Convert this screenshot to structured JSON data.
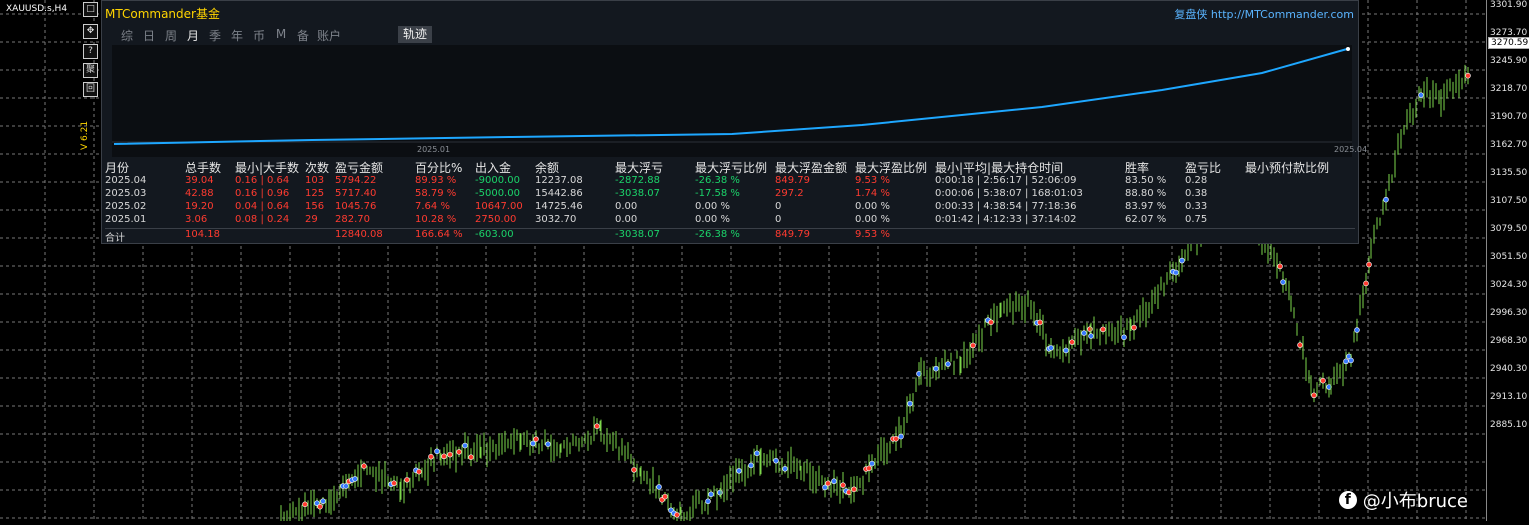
{
  "chart": {
    "symbol": "XAUUSD.s,H4",
    "version": "V 6.21",
    "current_price": "3270.59",
    "price_ticks": [
      "3301.90",
      "3273.70",
      "3245.90",
      "3218.70",
      "3190.70",
      "3162.70",
      "3135.50",
      "3107.50",
      "3079.50",
      "3051.50",
      "3024.30",
      "2996.30",
      "2968.30",
      "2940.30",
      "2913.10",
      "2885.10"
    ],
    "side_buttons": [
      "□",
      "✥",
      "?",
      "聚",
      "回"
    ]
  },
  "panel": {
    "brand": "MTCommander基金",
    "promo": "复盘侠 http://MTCommander.com",
    "tabs": [
      {
        "label": "综",
        "active": false
      },
      {
        "label": "日",
        "active": false
      },
      {
        "label": "周",
        "active": false
      },
      {
        "label": "月",
        "active": true
      },
      {
        "label": "季",
        "active": false
      },
      {
        "label": "年",
        "active": false
      },
      {
        "label": "币",
        "active": false
      },
      {
        "label": "M",
        "active": false
      },
      {
        "label": "备",
        "active": false
      },
      {
        "label": "账户",
        "active": false
      }
    ],
    "track_button": "轨迹",
    "mini_chart": {
      "date_start": "2025.01",
      "date_end": "2025.04",
      "line_color": "#1ea7ff"
    }
  },
  "stats": {
    "headers": {
      "month": "月份",
      "lots": "总手数",
      "minmax": "最小|大手数",
      "count": "次数",
      "pnl": "盈亏金额",
      "pct": "百分比%",
      "flow": "出入金",
      "bal": "余额",
      "float": "最大浮亏",
      "floatpct": "最大浮亏比例",
      "floatprofit": "最大浮盈金额",
      "floatprofitpct": "最大浮盈比例",
      "hold": "最小|平均|最大持仓时间",
      "win": "胜率",
      "ratio": "盈亏比",
      "margin": "最小预付款比例"
    },
    "rows": [
      {
        "month": "2025.04",
        "lots": "39.04",
        "minmax": "0.16 | 0.64",
        "count": "103",
        "pnl": "5794.22",
        "pct": "89.93 %",
        "flow": "-9000.00",
        "bal": "12237.08",
        "float": "-2872.88",
        "floatpct": "-26.38 %",
        "floatprofit": "849.79",
        "floatprofitpct": "9.53 %",
        "hold": "0:00:18 | 2:56:17 | 52:06:09",
        "win": "83.50 %",
        "ratio": "0.28",
        "margin": ""
      },
      {
        "month": "2025.03",
        "lots": "42.88",
        "minmax": "0.16 | 0.96",
        "count": "125",
        "pnl": "5717.40",
        "pct": "58.79 %",
        "flow": "-5000.00",
        "bal": "15442.86",
        "float": "-3038.07",
        "floatpct": "-17.58 %",
        "floatprofit": "297.2",
        "floatprofitpct": "1.74 %",
        "hold": "0:00:06 | 5:38:07 | 168:01:03",
        "win": "88.80 %",
        "ratio": "0.38",
        "margin": ""
      },
      {
        "month": "2025.02",
        "lots": "19.20",
        "minmax": "0.04 | 0.64",
        "count": "156",
        "pnl": "1045.76",
        "pct": "7.64 %",
        "flow": "10647.00",
        "bal": "14725.46",
        "float": "0.00",
        "floatpct": "0.00 %",
        "floatprofit": "0",
        "floatprofitpct": "0.00 %",
        "hold": "0:00:33 | 4:38:54 | 77:18:36",
        "win": "83.97 %",
        "ratio": "0.33",
        "margin": ""
      },
      {
        "month": "2025.01",
        "lots": "3.06",
        "minmax": "0.08 | 0.24",
        "count": "29",
        "pnl": "282.70",
        "pct": "10.28 %",
        "flow": "2750.00",
        "bal": "3032.70",
        "float": "0.00",
        "floatpct": "0.00 %",
        "floatprofit": "0",
        "floatprofitpct": "0.00 %",
        "hold": "0:01:42 | 4:12:33 | 37:14:02",
        "win": "62.07 %",
        "ratio": "0.75",
        "margin": ""
      }
    ],
    "total": {
      "month": "合计",
      "lots": "104.18",
      "pnl": "12840.08",
      "pct": "166.64 %",
      "flow": "-603.00",
      "float": "-3038.07",
      "floatpct": "-26.38 %",
      "floatprofit": "849.79",
      "floatprofitpct": "9.53 %"
    }
  },
  "watermark": {
    "icon": "facebook-icon",
    "text": "@小布bruce"
  }
}
